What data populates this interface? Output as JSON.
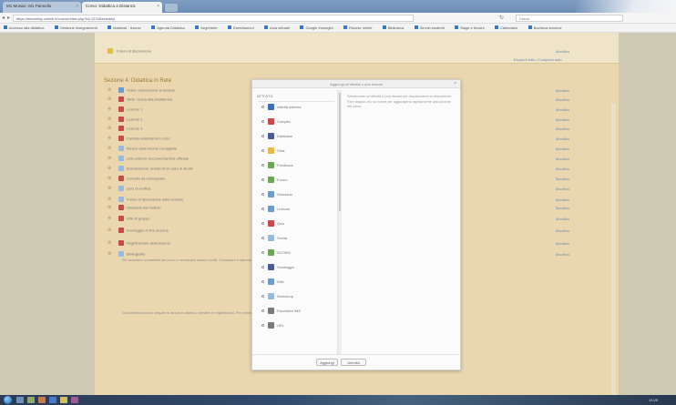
{
  "browser": {
    "tabs": [
      {
        "label": "M1 Mosaic: M1 Pannello"
      },
      {
        "label": "Corso: Didattica a Distanza"
      }
    ],
    "url": "https://elearning.unimib.it/course/view.php?id=1234&sesskey",
    "search_placeholder": "Cerca",
    "bookmarks": [
      "Accesso alla didattica",
      "Gestione insegnamenti",
      "Materiali - risorse",
      "Agenda Didattica",
      "Segreterie",
      "Esercitazioni",
      "Aula virtuale",
      "Google Immagini",
      "Risorse online",
      "Biblioteca",
      "Servizi studenti",
      "Stage e tirocini",
      "Calendario",
      "Bacheca annunci"
    ]
  },
  "colors": {
    "course_bg": "#ead7b0",
    "section_title": "#9a7840",
    "link": "#6f8fb5",
    "modal_bg": "#fbfbfb",
    "taskbar": "#2a3b56"
  },
  "top_section": {
    "item": "Forum di discussione",
    "edit": "Modifica",
    "toggle": "Espandi tutto / Comprimi tutto"
  },
  "section": {
    "title": "Sezione 4: Didattica in Rete"
  },
  "course_rows": [
    {
      "label": "Video: Introduzione al modulo",
      "icon": "video",
      "color": "#6d9bd1"
    },
    {
      "label": "Slide: Guida alla piattaforma",
      "icon": "pdf",
      "color": "#c94a4a"
    },
    {
      "label": "Lezione 1",
      "icon": "pdf",
      "color": "#c94a4a"
    },
    {
      "label": "Lezione 2",
      "icon": "pdf",
      "color": "#c94a4a"
    },
    {
      "label": "Lezione 3",
      "icon": "pdf",
      "color": "#c94a4a"
    },
    {
      "label": "Cartella materiali del corso",
      "icon": "folder",
      "color": "#c94a4a"
    },
    {
      "label": "Elenco delle risorse consigliate",
      "icon": "page",
      "color": "#9bb9dc"
    },
    {
      "label": "Link esterno: documentazione ufficiale",
      "icon": "page",
      "color": "#9bb9dc"
    },
    {
      "label": "Esercitazione: analisi di un caso di studio",
      "icon": "page",
      "color": "#9bb9dc"
    },
    {
      "label": "Compito da consegnare",
      "icon": "pdf",
      "color": "#c94a4a"
    },
    {
      "label": "Quiz di verifica",
      "icon": "page",
      "color": "#9bb9dc"
    },
    {
      "label": "Forum di discussione della sezione",
      "icon": "forum",
      "color": "#9bb9dc"
    },
    {
      "label": "Glossario del modulo",
      "icon": "pdf",
      "color": "#c94a4a"
    },
    {
      "label": "Wiki di gruppo",
      "icon": "pdf",
      "color": "#c94a4a"
    },
    {
      "label": "Sondaggio di fine sezione",
      "icon": "pdf",
      "color": "#c94a4a"
    },
    {
      "label": "Registrazione della lezione",
      "icon": "pdf",
      "color": "#c94a4a"
    },
    {
      "label": "Bibliografia",
      "icon": "page",
      "color": "#9bb9dc"
    }
  ],
  "row_edit_label": "Modifica",
  "descriptions": [
    "Per accedere ai materiali del corso è necessario essere iscritti. Consultare il calendario delle lezioni e le indicazioni riportate nella pagina principale.",
    "Gli studenti possono seguire le lezioni in diretta o rivedere le registrazioni. Per eventuali problemi tecnici contattare il supporto della piattaforma."
  ],
  "modal": {
    "title": "Aggiungi un'attività o una risorsa",
    "list_header": "ATTIVITÀ",
    "activities": [
      {
        "label": "Attività esterna",
        "color": "#3a6fb0"
      },
      {
        "label": "Compito",
        "color": "#c94a4a"
      },
      {
        "label": "Database",
        "color": "#4a5a9a"
      },
      {
        "label": "Chat",
        "color": "#e5b84a"
      },
      {
        "label": "Feedback",
        "color": "#6aa84f"
      },
      {
        "label": "Forum",
        "color": "#6aa84f"
      },
      {
        "label": "Glossario",
        "color": "#6d9bd1"
      },
      {
        "label": "Lezione",
        "color": "#6d9bd1"
      },
      {
        "label": "Quiz",
        "color": "#c94a4a"
      },
      {
        "label": "Scelta",
        "color": "#9bb9dc"
      },
      {
        "label": "SCORM",
        "color": "#6aa84f"
      },
      {
        "label": "Sondaggio",
        "color": "#4a5a9a"
      },
      {
        "label": "Wiki",
        "color": "#6d9bd1"
      },
      {
        "label": "Workshop",
        "color": "#9bb9dc"
      },
      {
        "label": "Pacchetto IMS",
        "color": "#7a7a7a"
      },
      {
        "label": "URL",
        "color": "#7a7a7a"
      }
    ],
    "help_text": "Selezionare un'attività o una risorsa per visualizzarne la descrizione. Fare doppio clic sul nome per aggiungerla rapidamente alla sezione del corso.",
    "add_label": "Aggiungi",
    "cancel_label": "Annulla"
  },
  "taskbar": {
    "clock": "14:25"
  }
}
